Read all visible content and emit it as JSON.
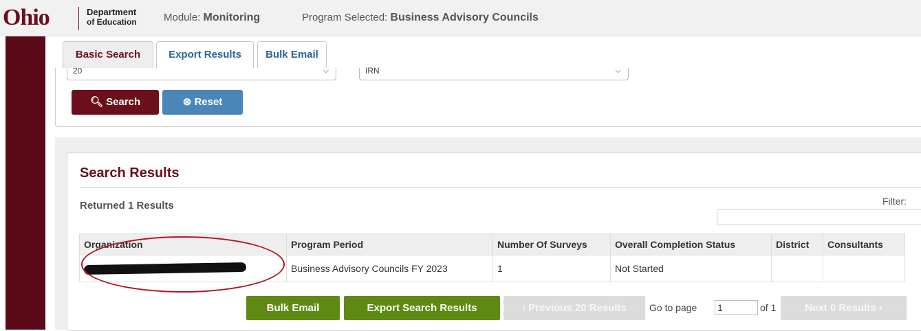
{
  "header": {
    "logo_ohio": "Ohio",
    "logo_dept_line1": "Department",
    "logo_dept_line2": "of Education",
    "module_label": "Module:",
    "module_value": "Monitoring",
    "program_label": "Program Selected:",
    "program_value": "Business Advisory Councils"
  },
  "tabs": [
    {
      "label": "Basic Search",
      "active": true
    },
    {
      "label": "Export Results",
      "active": false
    },
    {
      "label": "Bulk Email",
      "active": false
    }
  ],
  "search": {
    "select1_value": "20",
    "select2_value": "IRN",
    "search_button": "Search",
    "reset_button": "Reset"
  },
  "results": {
    "title": "Search Results",
    "returned": "Returned 1 Results",
    "filter_label": "Filter:",
    "columns": [
      "Organization",
      "Program Period",
      "Number Of Surveys",
      "Overall Completion Status",
      "District",
      "Consultants"
    ],
    "rows": [
      {
        "program_period": "Business Advisory Councils FY 2023",
        "surveys": "1",
        "status": "Not Started",
        "district": "",
        "consultants": ""
      }
    ]
  },
  "pager": {
    "bulk_email": "Bulk Email",
    "export": "Export Search Results",
    "previous": "Previous 20 Results",
    "goto_label": "Go to page",
    "page_value": "1",
    "of_label": "of 1",
    "next": "Next 0 Results"
  },
  "colors": {
    "brand": "#6b0f1a",
    "link": "#2a6496",
    "green": "#5e8a14",
    "reset_blue": "#4a86b8"
  }
}
